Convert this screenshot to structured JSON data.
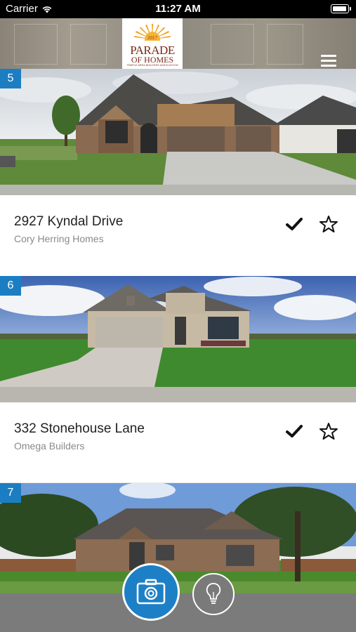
{
  "status_bar": {
    "carrier": "Carrier",
    "time": "11:27 AM"
  },
  "header": {
    "logo": {
      "year": "2017",
      "line1": "PARADE",
      "line2": "OF HOMES",
      "line3": "TEMPLE AREA BUILDERS ASSOCIATION"
    },
    "menu_icon": "hamburger-menu-icon"
  },
  "listings": [
    {
      "number": "5",
      "address": "2927 Kyndal Drive",
      "builder": "Cory Herring Homes"
    },
    {
      "number": "6",
      "address": "332 Stonehouse Lane",
      "builder": "Omega Builders"
    },
    {
      "number": "7"
    }
  ],
  "bottom_bar": {
    "camera_icon": "camera-icon",
    "tips_icon": "lightbulb-icon"
  },
  "colors": {
    "accent": "#1c7ec2",
    "bottom_bar": "#7b7b7b",
    "badge": "#1c7ec2"
  }
}
